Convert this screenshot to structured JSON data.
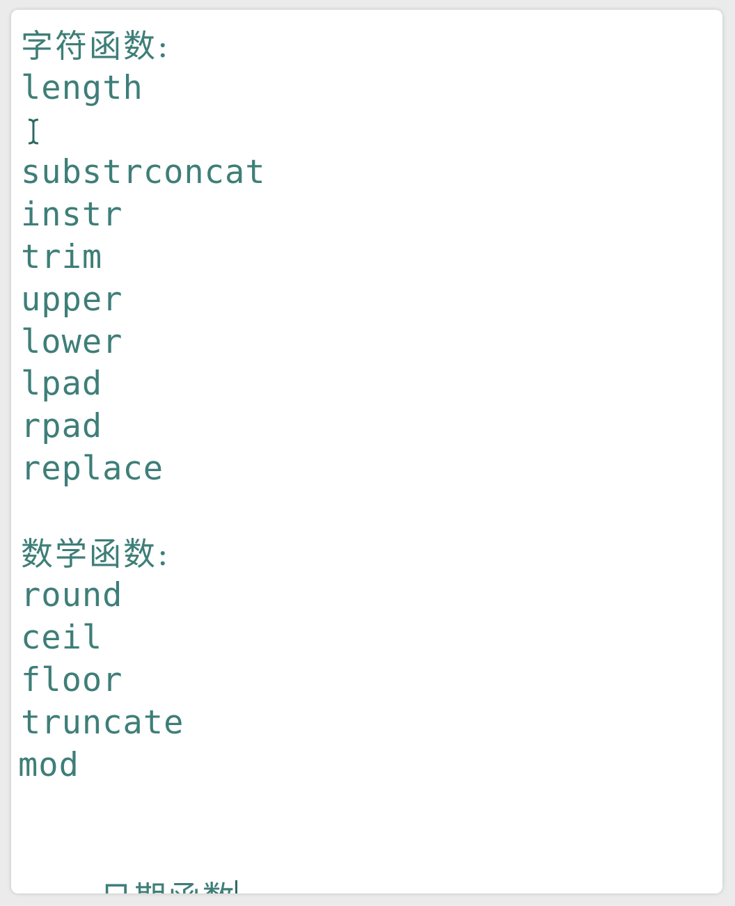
{
  "editor": {
    "string_section": {
      "heading": "字符函数:",
      "items": [
        "length",
        "concat",
        "substr",
        "instr",
        "trim",
        "upper",
        "lower",
        "lpad",
        "rpad",
        "replace"
      ]
    },
    "math_section": {
      "heading": "数学函数:",
      "items": [
        "round",
        "ceil",
        "floor",
        "truncate",
        "mod"
      ]
    },
    "date_section": {
      "heading": "日期函数"
    }
  },
  "colors": {
    "text": "#3e7e78",
    "background": "#ffffff",
    "frame": "#ebebeb"
  },
  "icons": [
    "text-cursor-ibeam-icon",
    "text-caret-icon"
  ]
}
